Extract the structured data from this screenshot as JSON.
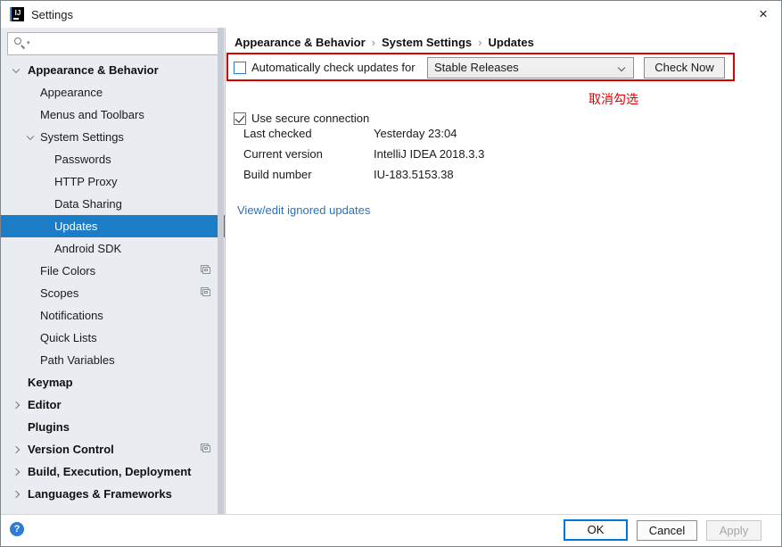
{
  "window": {
    "title": "Settings"
  },
  "icons": {
    "app_glyph": "IJ",
    "close_glyph": "×",
    "search_dropdown_glyph": "▾",
    "help_glyph": "?"
  },
  "colors": {
    "selection_blue": "#1c7cc5",
    "link_blue": "#2673c2",
    "annotation_red": "#e00000",
    "ok_border_blue": "#0078d7",
    "help_blue": "#2f7dd3",
    "sidebar_bg": "#e9ecf0"
  },
  "sidebar": {
    "search_value": "",
    "items": [
      {
        "label": "Appearance & Behavior",
        "indent": 0,
        "bold": true,
        "chevron": "down",
        "selected": false,
        "badge": false
      },
      {
        "label": "Appearance",
        "indent": 1,
        "bold": false,
        "chevron": "none",
        "selected": false,
        "badge": false
      },
      {
        "label": "Menus and Toolbars",
        "indent": 1,
        "bold": false,
        "chevron": "none",
        "selected": false,
        "badge": false
      },
      {
        "label": "System Settings",
        "indent": 1,
        "bold": false,
        "chevron": "down",
        "selected": false,
        "badge": false
      },
      {
        "label": "Passwords",
        "indent": 2,
        "bold": false,
        "chevron": "none",
        "selected": false,
        "badge": false
      },
      {
        "label": "HTTP Proxy",
        "indent": 2,
        "bold": false,
        "chevron": "none",
        "selected": false,
        "badge": false
      },
      {
        "label": "Data Sharing",
        "indent": 2,
        "bold": false,
        "chevron": "none",
        "selected": false,
        "badge": false
      },
      {
        "label": "Updates",
        "indent": 2,
        "bold": false,
        "chevron": "none",
        "selected": true,
        "badge": false
      },
      {
        "label": "Android SDK",
        "indent": 2,
        "bold": false,
        "chevron": "none",
        "selected": false,
        "badge": false
      },
      {
        "label": "File Colors",
        "indent": 1,
        "bold": false,
        "chevron": "none",
        "selected": false,
        "badge": true
      },
      {
        "label": "Scopes",
        "indent": 1,
        "bold": false,
        "chevron": "none",
        "selected": false,
        "badge": true
      },
      {
        "label": "Notifications",
        "indent": 1,
        "bold": false,
        "chevron": "none",
        "selected": false,
        "badge": false
      },
      {
        "label": "Quick Lists",
        "indent": 1,
        "bold": false,
        "chevron": "none",
        "selected": false,
        "badge": false
      },
      {
        "label": "Path Variables",
        "indent": 1,
        "bold": false,
        "chevron": "none",
        "selected": false,
        "badge": false
      },
      {
        "label": "Keymap",
        "indent": 0,
        "bold": true,
        "chevron": "none",
        "selected": false,
        "badge": false
      },
      {
        "label": "Editor",
        "indent": 0,
        "bold": true,
        "chevron": "right",
        "selected": false,
        "badge": false
      },
      {
        "label": "Plugins",
        "indent": 0,
        "bold": true,
        "chevron": "none",
        "selected": false,
        "badge": false
      },
      {
        "label": "Version Control",
        "indent": 0,
        "bold": true,
        "chevron": "right",
        "selected": false,
        "badge": true
      },
      {
        "label": "Build, Execution, Deployment",
        "indent": 0,
        "bold": true,
        "chevron": "right",
        "selected": false,
        "badge": false
      },
      {
        "label": "Languages & Frameworks",
        "indent": 0,
        "bold": true,
        "chevron": "right",
        "selected": false,
        "badge": false
      }
    ]
  },
  "breadcrumb": {
    "items": [
      "Appearance & Behavior",
      "System Settings",
      "Updates"
    ],
    "separator": "›"
  },
  "main": {
    "auto_check": {
      "label": "Automatically check updates for",
      "checked": false
    },
    "channel_select": {
      "value": "Stable Releases"
    },
    "check_now_label": "Check Now",
    "secure": {
      "label": "Use secure connection",
      "checked": true
    },
    "annotation": "取消勾选",
    "details": [
      {
        "label": "Last checked",
        "value": "Yesterday 23:04"
      },
      {
        "label": "Current version",
        "value": "IntelliJ IDEA 2018.3.3"
      },
      {
        "label": "Build number",
        "value": "IU-183.5153.38"
      }
    ],
    "link": "View/edit ignored updates"
  },
  "footer": {
    "ok": "OK",
    "cancel": "Cancel",
    "apply": "Apply"
  }
}
